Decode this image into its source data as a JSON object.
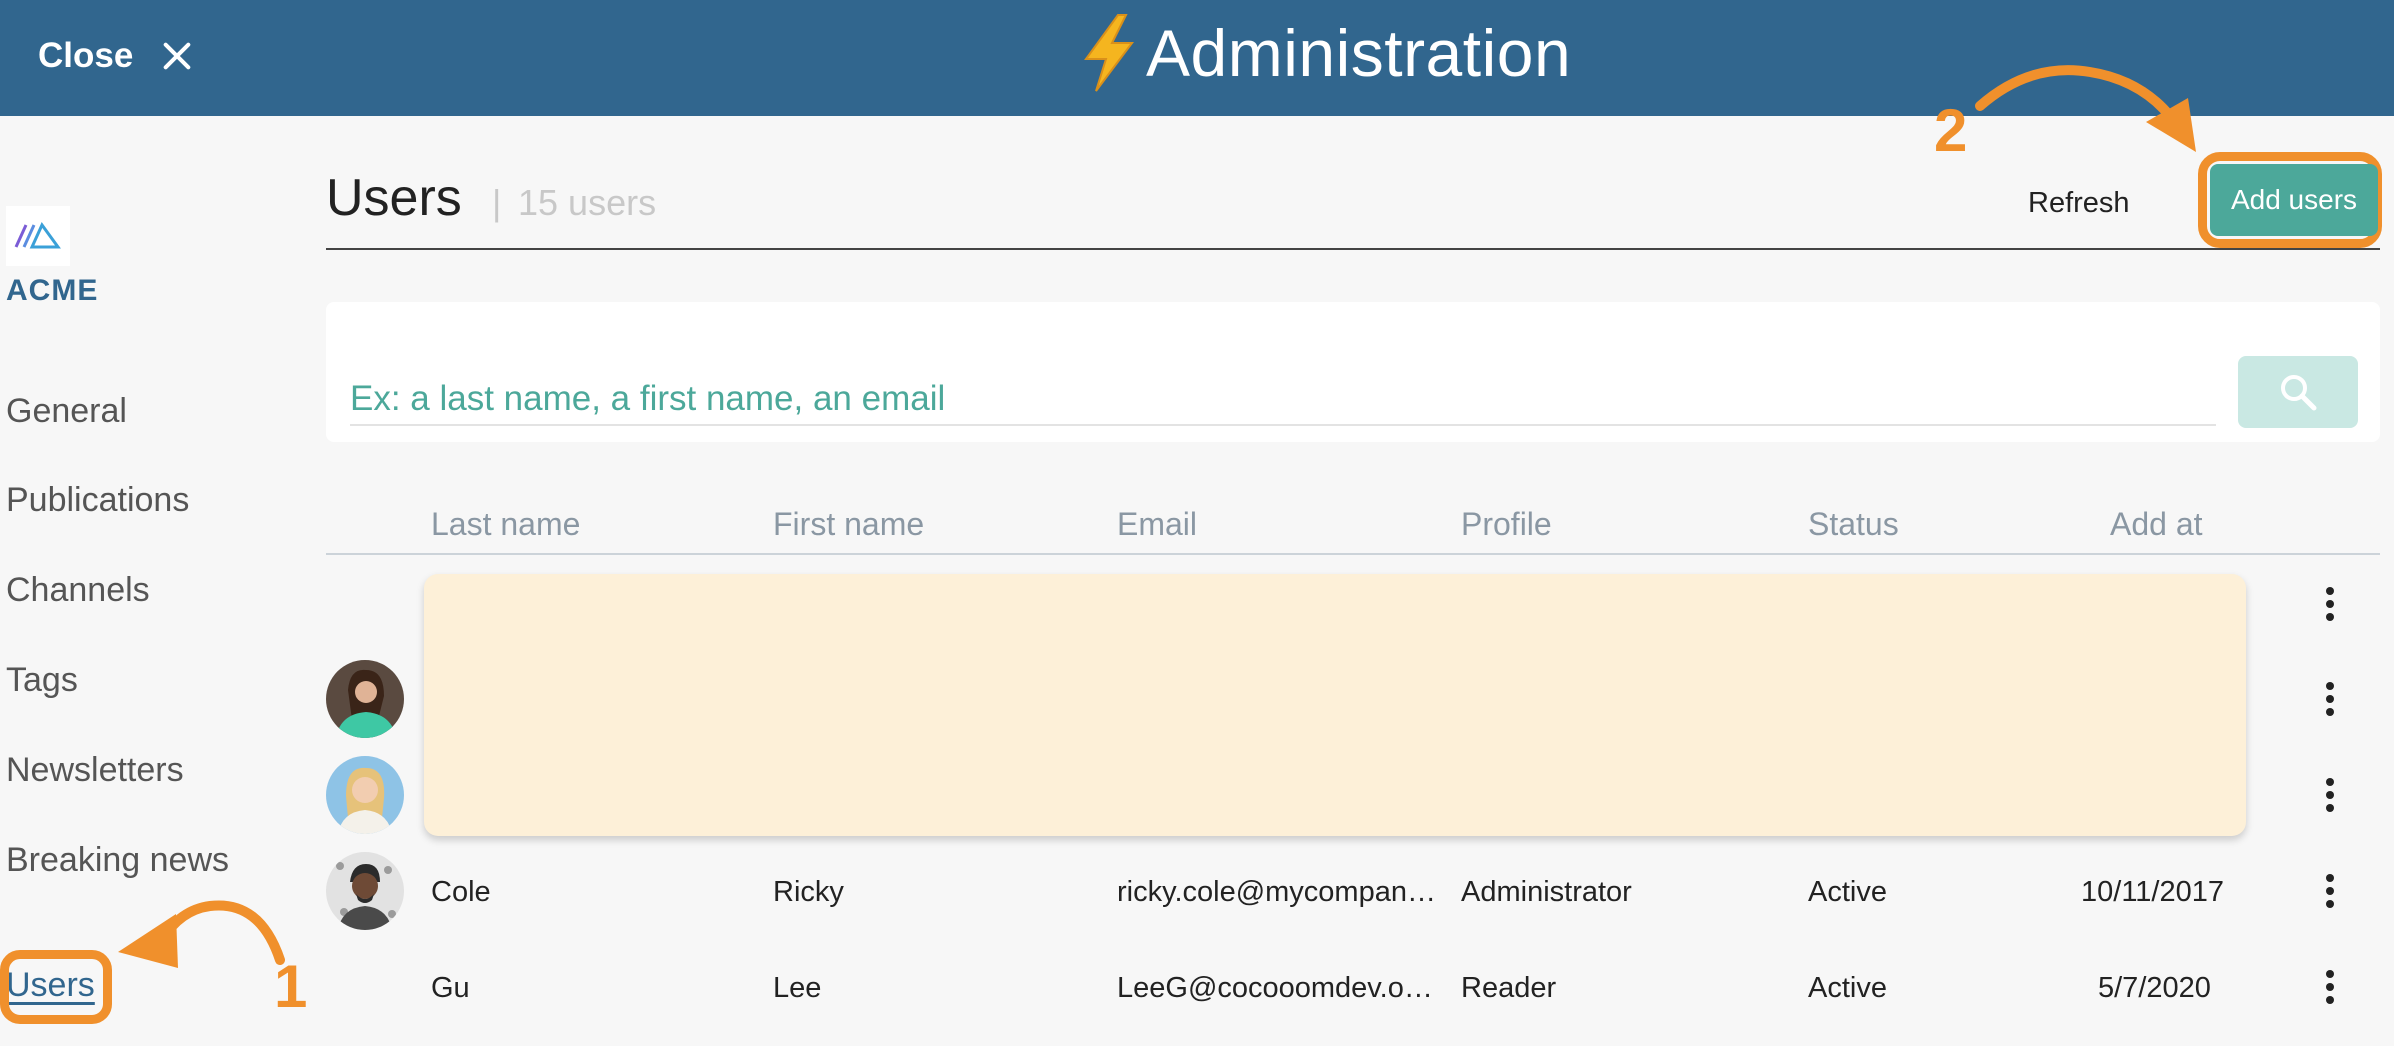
{
  "header": {
    "close_label": "Close",
    "title": "Administration"
  },
  "sidebar": {
    "logo_text": "ACME",
    "items": [
      {
        "label": "General"
      },
      {
        "label": "Publications"
      },
      {
        "label": "Channels"
      },
      {
        "label": "Tags"
      },
      {
        "label": "Newsletters"
      },
      {
        "label": "Breaking news"
      },
      {
        "label": "Users"
      }
    ]
  },
  "page": {
    "title": "Users",
    "separator": "|",
    "count": "15 users",
    "refresh_label": "Refresh",
    "add_label": "Add users"
  },
  "search": {
    "placeholder": "Ex: a last name, a first name, an email"
  },
  "table": {
    "columns": [
      "Last name",
      "First name",
      "Email",
      "Profile",
      "Status",
      "Add at"
    ],
    "rows": [
      {
        "last": "Cole",
        "first": "Ricky",
        "email": "ricky.cole@mycompan…",
        "profile": "Administrator",
        "status": "Active",
        "added": "10/11/2017"
      },
      {
        "last": "Gu",
        "first": "Lee",
        "email": "LeeG@cocooomdev.o…",
        "profile": "Reader",
        "status": "Active",
        "added": "5/7/2020"
      }
    ]
  },
  "annotations": {
    "step1": "1",
    "step2": "2",
    "color": "#f0902c"
  },
  "colors": {
    "topbar": "#31668e",
    "accent": "#4ca89a",
    "highlight": "#f0902c"
  }
}
